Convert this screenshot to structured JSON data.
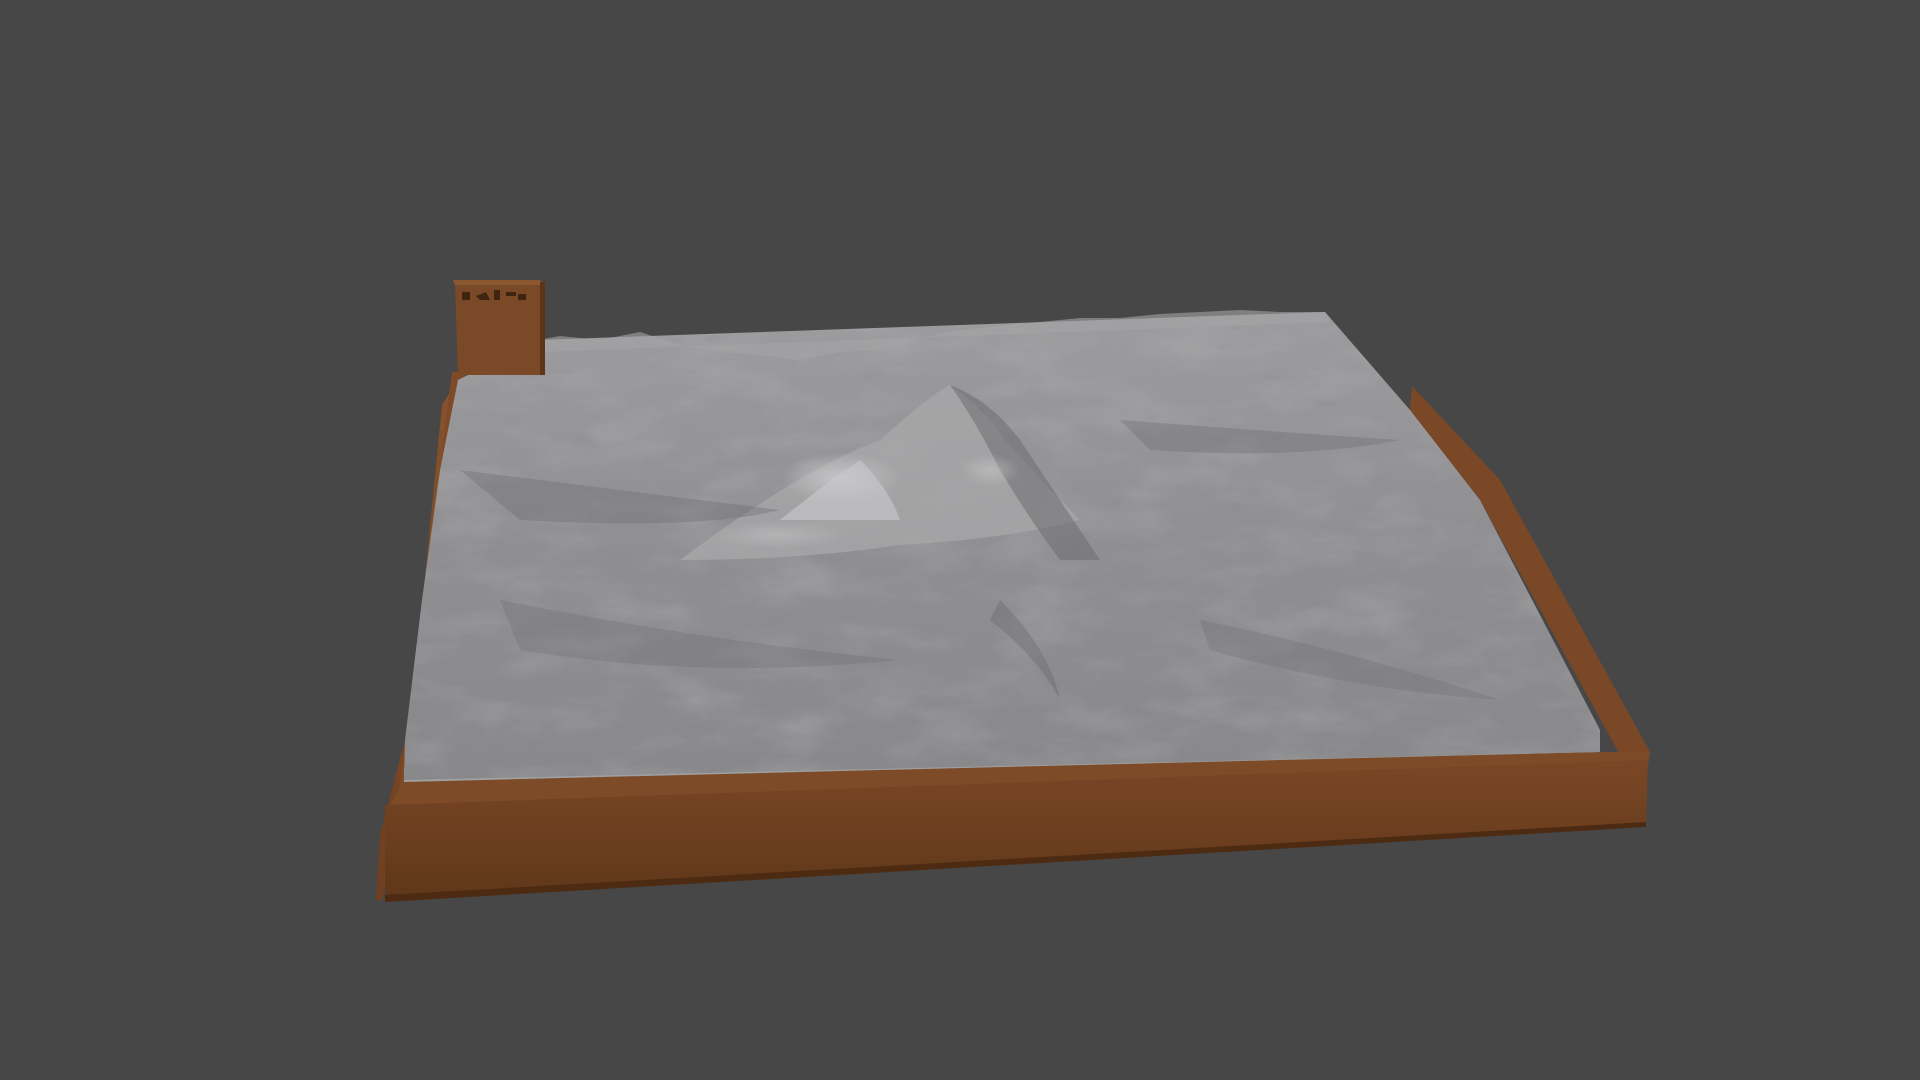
{
  "viewport": {
    "background_color": "#474747",
    "object": "terrain-relief-model"
  },
  "model": {
    "base_color": "#6b3f1e",
    "base_front_color": "#6a3d1f",
    "base_side_color": "#5c3418",
    "base_top_color": "#7a4a27",
    "terrain_color": "#8f8f91",
    "terrain_highlight_color": "#b5b5b7",
    "terrain_shadow_color": "#5f5f62",
    "label_block_color": "#74462a"
  }
}
